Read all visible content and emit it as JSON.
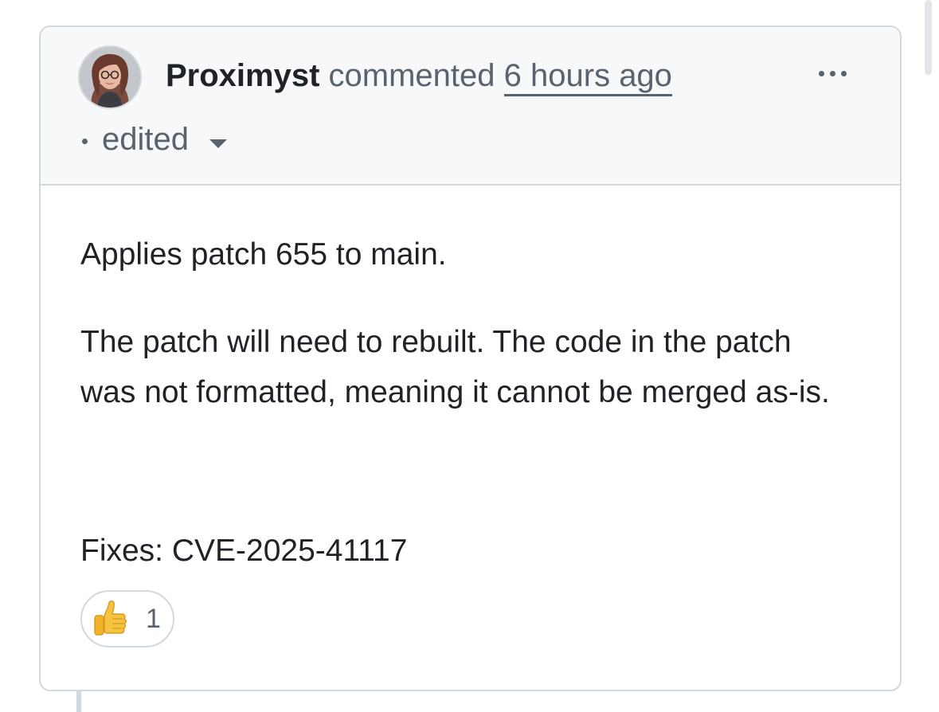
{
  "comment": {
    "author": "Proximyst",
    "action": "commented",
    "timestamp": "6 hours ago",
    "edited_label": "edited",
    "body": {
      "paragraph_1": "Applies patch 655 to main.",
      "paragraph_2": "The patch will need to rebuilt. The code in the patch was not formatted, meaning it cannot be merged as-is.",
      "paragraph_3": "Fixes: CVE-2025-41117"
    },
    "reactions": [
      {
        "icon": "thumbs-up-icon",
        "count": "1"
      }
    ]
  },
  "colors": {
    "header_bg": "#f6f8fa",
    "border": "#d1d9e0",
    "text_primary": "#1f2328",
    "text_muted": "#59636e"
  }
}
